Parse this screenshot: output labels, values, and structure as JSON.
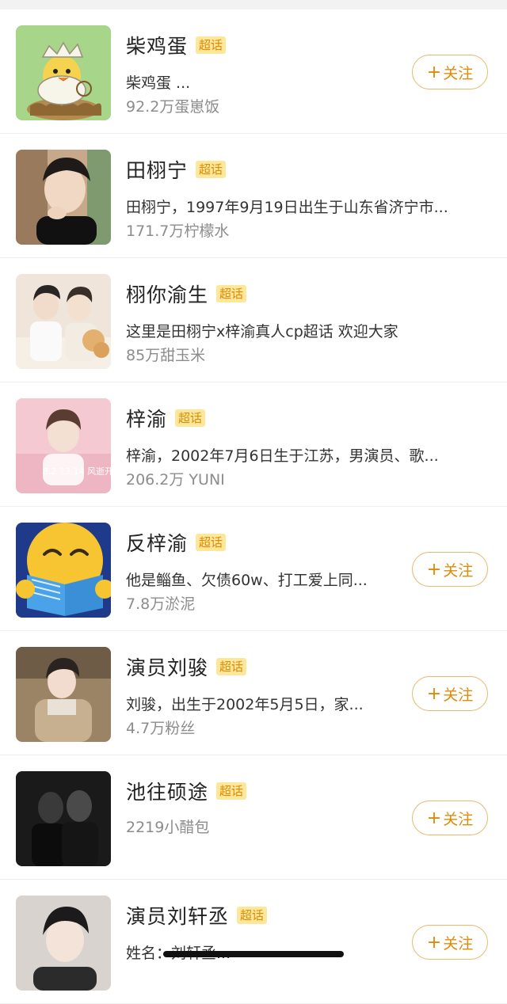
{
  "follow_label": "关注",
  "follow_plus": "+",
  "items": [
    {
      "title": "柴鸡蛋",
      "badge": "超话",
      "desc": "柴鸡蛋 ...",
      "count": "92.2万蛋崽饭",
      "avatar": "chick-cartoon-avatar",
      "following": false
    },
    {
      "title": "田栩宁",
      "badge": "超话",
      "desc": "田栩宁，1997年9月19日出生于山东省济宁市...",
      "count": "171.7万柠檬水",
      "avatar": "portrait-photo-avatar",
      "following": true
    },
    {
      "title": "栩你渝生",
      "badge": "超话",
      "desc": "这里是田栩宁x梓渝真人cp超话 欢迎大家",
      "count": "85万甜玉米",
      "avatar": "couple-photo-avatar",
      "following": true
    },
    {
      "title": "梓渝",
      "badge": "超话",
      "desc": "梓渝，2002年7月6日生于江苏，男演员、歌...",
      "count": "206.2万 YUNI",
      "avatar": "poster-photo-avatar",
      "poster_text": "8.2 13.14 风逝开售",
      "following": true
    },
    {
      "title": "反梓渝",
      "badge": "超话",
      "desc": "他是鲻鱼、欠债60w、打工爱上同...",
      "count": "7.8万淤泥",
      "avatar": "emoji-reading-avatar",
      "following": false
    },
    {
      "title": "演员刘骏",
      "badge": "超话",
      "desc": "刘骏，出生于2002年5月5日，家...",
      "count": "4.7万粉丝",
      "avatar": "portrait-photo-avatar",
      "following": false
    },
    {
      "title": "池往硕途",
      "badge": "超话",
      "desc": "",
      "count": "2219小醋包",
      "avatar": "dark-photo-avatar",
      "following": false
    },
    {
      "title": "演员刘轩丞",
      "badge": "超话",
      "desc": "姓名：刘轩丞...",
      "count": "",
      "avatar": "portrait-photo-avatar",
      "following": false
    }
  ]
}
